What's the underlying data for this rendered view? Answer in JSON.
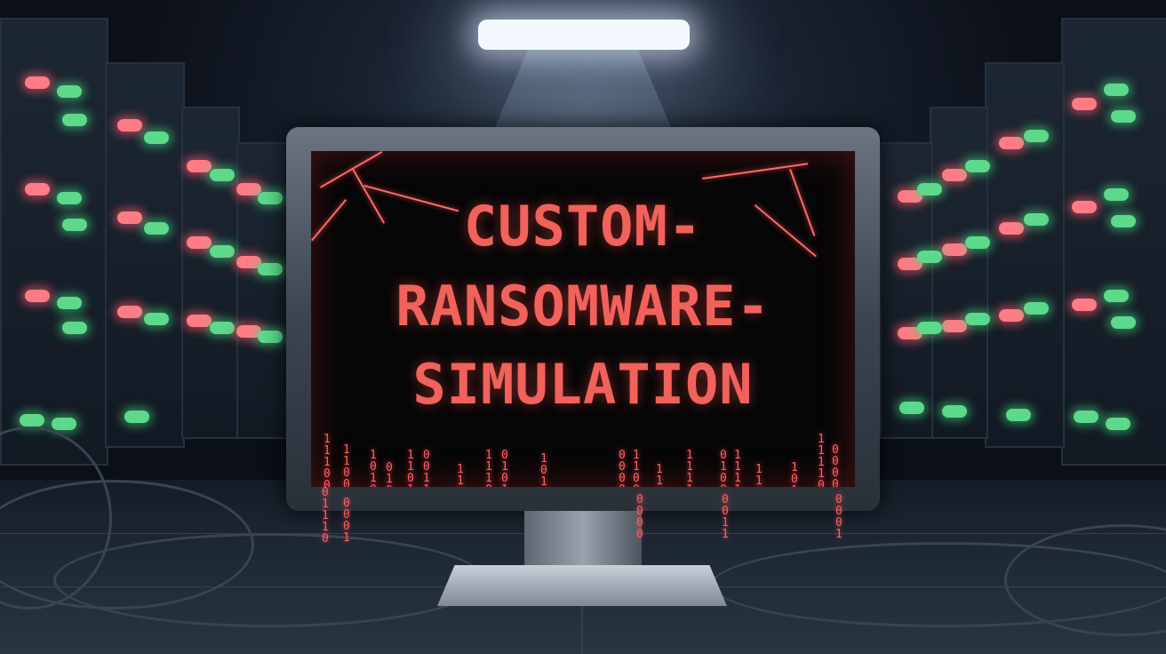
{
  "screen": {
    "title_lines": [
      "CUSTOM-",
      "RANSOMWARE-",
      "SIMULATION"
    ]
  },
  "colors": {
    "text_red": "#f0625b",
    "led_red": "#ff7b86",
    "led_green": "#5cd98a",
    "screen_bg": "#060607",
    "frame_gray": "#4a525c"
  },
  "icons": [
    "server-rack",
    "status-led",
    "crack",
    "binary-rain",
    "cable"
  ]
}
